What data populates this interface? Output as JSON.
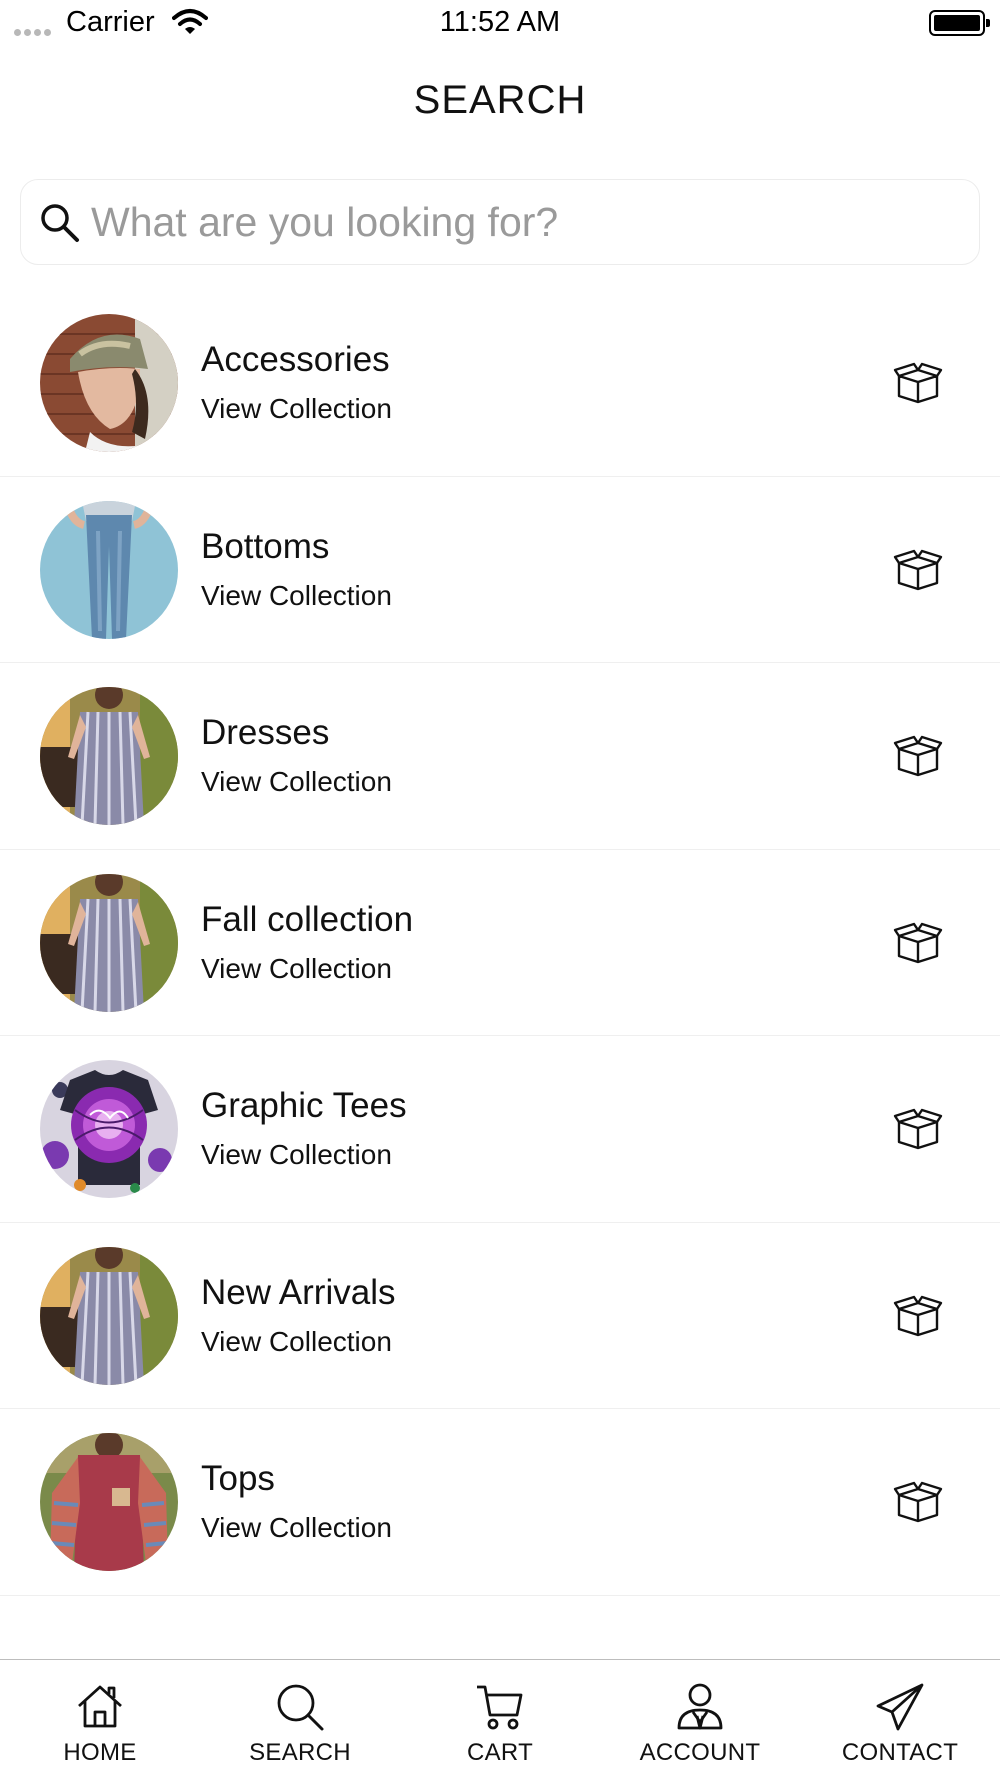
{
  "status_bar": {
    "carrier": "Carrier",
    "time": "11:52 AM"
  },
  "header": {
    "title": "SEARCH"
  },
  "search": {
    "placeholder": "What are you looking for?",
    "value": ""
  },
  "collections": [
    {
      "title": "Accessories",
      "subtitle": "View Collection",
      "thumb": "woman-camo-cap-photo"
    },
    {
      "title": "Bottoms",
      "subtitle": "View Collection",
      "thumb": "skinny-jeans-photo"
    },
    {
      "title": "Dresses",
      "subtitle": "View Collection",
      "thumb": "striped-wrap-dress-photo"
    },
    {
      "title": "Fall collection",
      "subtitle": "View Collection",
      "thumb": "striped-wrap-dress-photo"
    },
    {
      "title": "Graphic Tees",
      "subtitle": "View Collection",
      "thumb": "purple-tie-dye-tee-photo"
    },
    {
      "title": "New Arrivals",
      "subtitle": "View Collection",
      "thumb": "striped-wrap-dress-photo"
    },
    {
      "title": "Tops",
      "subtitle": "View Collection",
      "thumb": "red-striped-sleeve-top-photo"
    }
  ],
  "tab_bar": {
    "tabs": [
      {
        "label": "HOME",
        "icon": "home-icon"
      },
      {
        "label": "SEARCH",
        "icon": "search-icon"
      },
      {
        "label": "CART",
        "icon": "cart-icon"
      },
      {
        "label": "ACCOUNT",
        "icon": "account-icon"
      },
      {
        "label": "CONTACT",
        "icon": "paper-plane-icon"
      }
    ]
  },
  "colors": {
    "text": "#111111",
    "placeholder": "#9a9a9a",
    "divider": "#efefef",
    "background": "#ffffff"
  }
}
